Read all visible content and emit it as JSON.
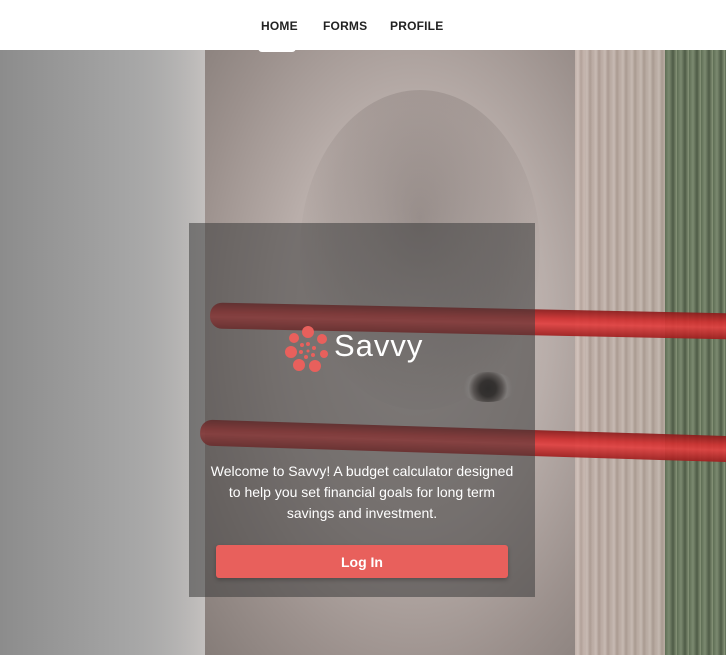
{
  "nav": {
    "items": [
      {
        "label": "HOME"
      },
      {
        "label": "FORMS"
      },
      {
        "label": "PROFILE"
      }
    ]
  },
  "brand": {
    "name": "Savvy",
    "logo_icon": "dotted-flower-icon",
    "accent_color": "#e8605c"
  },
  "welcome": {
    "text": "Welcome to Savvy! A budget calculator designed to help you set financial goals for long term savings and investment."
  },
  "login": {
    "label": "Log In"
  }
}
